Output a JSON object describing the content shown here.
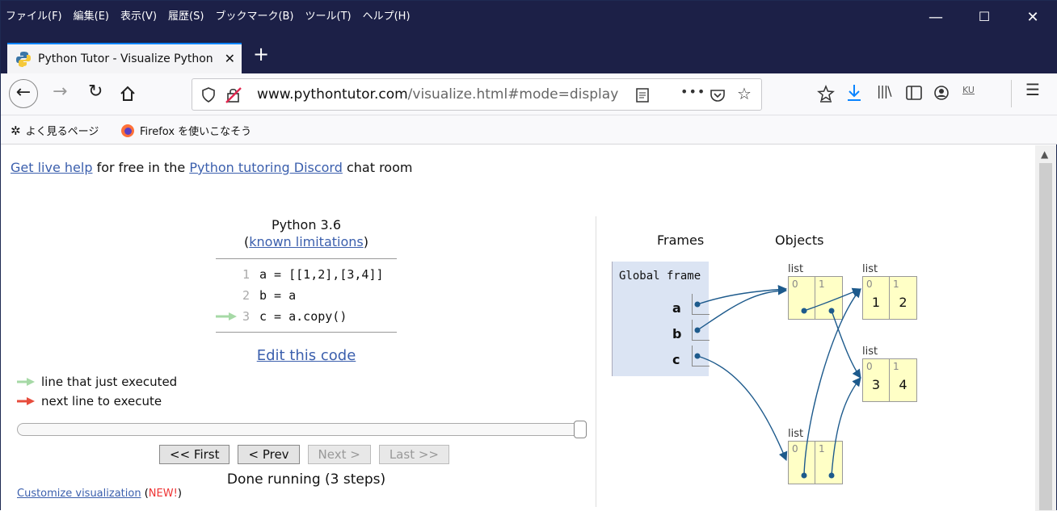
{
  "menubar": {
    "items": [
      "ファイル(F)",
      "編集(E)",
      "表示(V)",
      "履歴(S)",
      "ブックマーク(B)",
      "ツール(T)",
      "ヘルプ(H)"
    ],
    "minimize": "—",
    "maximize": "☐",
    "close": "✕"
  },
  "tab": {
    "title": "Python Tutor - Visualize Python",
    "close": "✕",
    "new_tab": "+"
  },
  "nav": {
    "url_host": "www.pythontutor.com",
    "url_path": "/visualize.html#mode=display",
    "more": "•••"
  },
  "bookmarks": {
    "item1": "よく見るページ",
    "item2": "Firefox を使いこなそう"
  },
  "page": {
    "help_link": "Get live help",
    "help_mid": " for free in the ",
    "discord_link": "Python tutoring Discord",
    "help_end": " chat room",
    "python_version": "Python 3.6",
    "paren_open": "(",
    "limitations_link": "known limitations",
    "paren_close": ")",
    "code_lines": [
      {
        "no": "1",
        "text": "a = [[1,2],[3,4]]"
      },
      {
        "no": "2",
        "text": "b = a"
      },
      {
        "no": "3",
        "text": "c = a.copy()"
      }
    ],
    "edit_link": "Edit this code",
    "legend_green": "line that just executed",
    "legend_red": "next line to execute",
    "btn_first": "<< First",
    "btn_prev": "< Prev",
    "btn_next": "Next >",
    "btn_last": "Last >>",
    "status": "Done running (3 steps)",
    "customize_link": "Customize visualization",
    "customize_new_open": " (",
    "customize_new": "NEW!",
    "customize_new_close": ")"
  },
  "viz": {
    "frames_header": "Frames",
    "objects_header": "Objects",
    "global_frame": "Global frame",
    "vars": [
      "a",
      "b",
      "c"
    ],
    "list_label": "list",
    "idx0": "0",
    "idx1": "1",
    "list_top_right": {
      "v0": "1",
      "v1": "2"
    },
    "list_mid_right": {
      "v0": "3",
      "v1": "4"
    }
  },
  "colors": {
    "accent_tab": "#0a84ff",
    "link": "#3b5fad",
    "arrow": "#1d5a8c",
    "list_bg": "#ffffc6",
    "frame_bg": "#dbe4f3",
    "green_arrow": "#a6d9a6",
    "red_arrow": "#e74c3c"
  }
}
